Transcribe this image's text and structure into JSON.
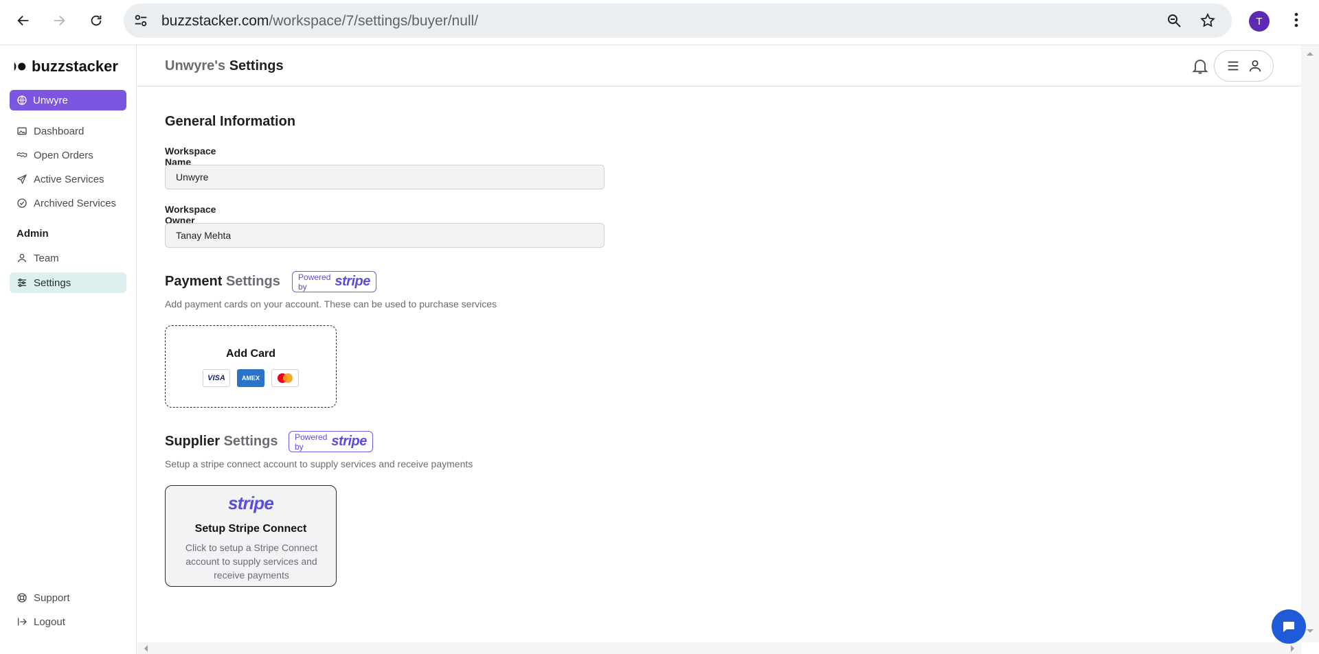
{
  "browser": {
    "url_host": "buzzstacker.com",
    "url_path": "/workspace/7/settings/buyer/null/",
    "profile_initial": "T"
  },
  "sidebar": {
    "logo_text": "buzzstacker",
    "workspace_button": "Unwyre",
    "items": [
      {
        "label": "Dashboard",
        "icon": "image-icon"
      },
      {
        "label": "Open Orders",
        "icon": "handshake-icon"
      },
      {
        "label": "Active Services",
        "icon": "send-icon"
      },
      {
        "label": "Archived Services",
        "icon": "check-circle-icon"
      }
    ],
    "admin_heading": "Admin",
    "admin_items": [
      {
        "label": "Team",
        "icon": "user-icon"
      },
      {
        "label": "Settings",
        "icon": "sliders-icon",
        "active": true
      }
    ],
    "footer_items": [
      {
        "label": "Support",
        "icon": "lifebuoy-icon"
      },
      {
        "label": "Logout",
        "icon": "logout-icon"
      }
    ]
  },
  "header": {
    "workspace_part": "Unwyre's",
    "title_part": "Settings"
  },
  "general": {
    "heading": "General Information",
    "workspace_name_label": "Workspace Name",
    "workspace_name_value": "Unwyre",
    "workspace_owner_label": "Workspace Owner",
    "workspace_owner_value": "Tanay Mehta"
  },
  "payment": {
    "heading_strong": "Payment",
    "heading_muted": "Settings",
    "badge_prefix": "Powered by",
    "badge_brand": "stripe",
    "description": "Add payment cards on your account. These can be used to purchase services",
    "add_card_label": "Add Card",
    "card_brands": [
      "VISA",
      "AMEX",
      "mastercard"
    ]
  },
  "supplier": {
    "heading_strong": "Supplier",
    "heading_muted": "Settings",
    "badge_prefix": "Powered by",
    "badge_brand": "stripe",
    "description": "Setup a stripe connect account to supply services and receive payments",
    "card_brand": "stripe",
    "card_title": "Setup Stripe Connect",
    "card_description": "Click to setup a Stripe Connect account to supply services and receive payments"
  },
  "colors": {
    "accent_purple": "#7c55e0",
    "stripe_purple": "#5a4ce0",
    "active_item_bg": "#ddefef",
    "chat_blue": "#1f5bd8"
  }
}
